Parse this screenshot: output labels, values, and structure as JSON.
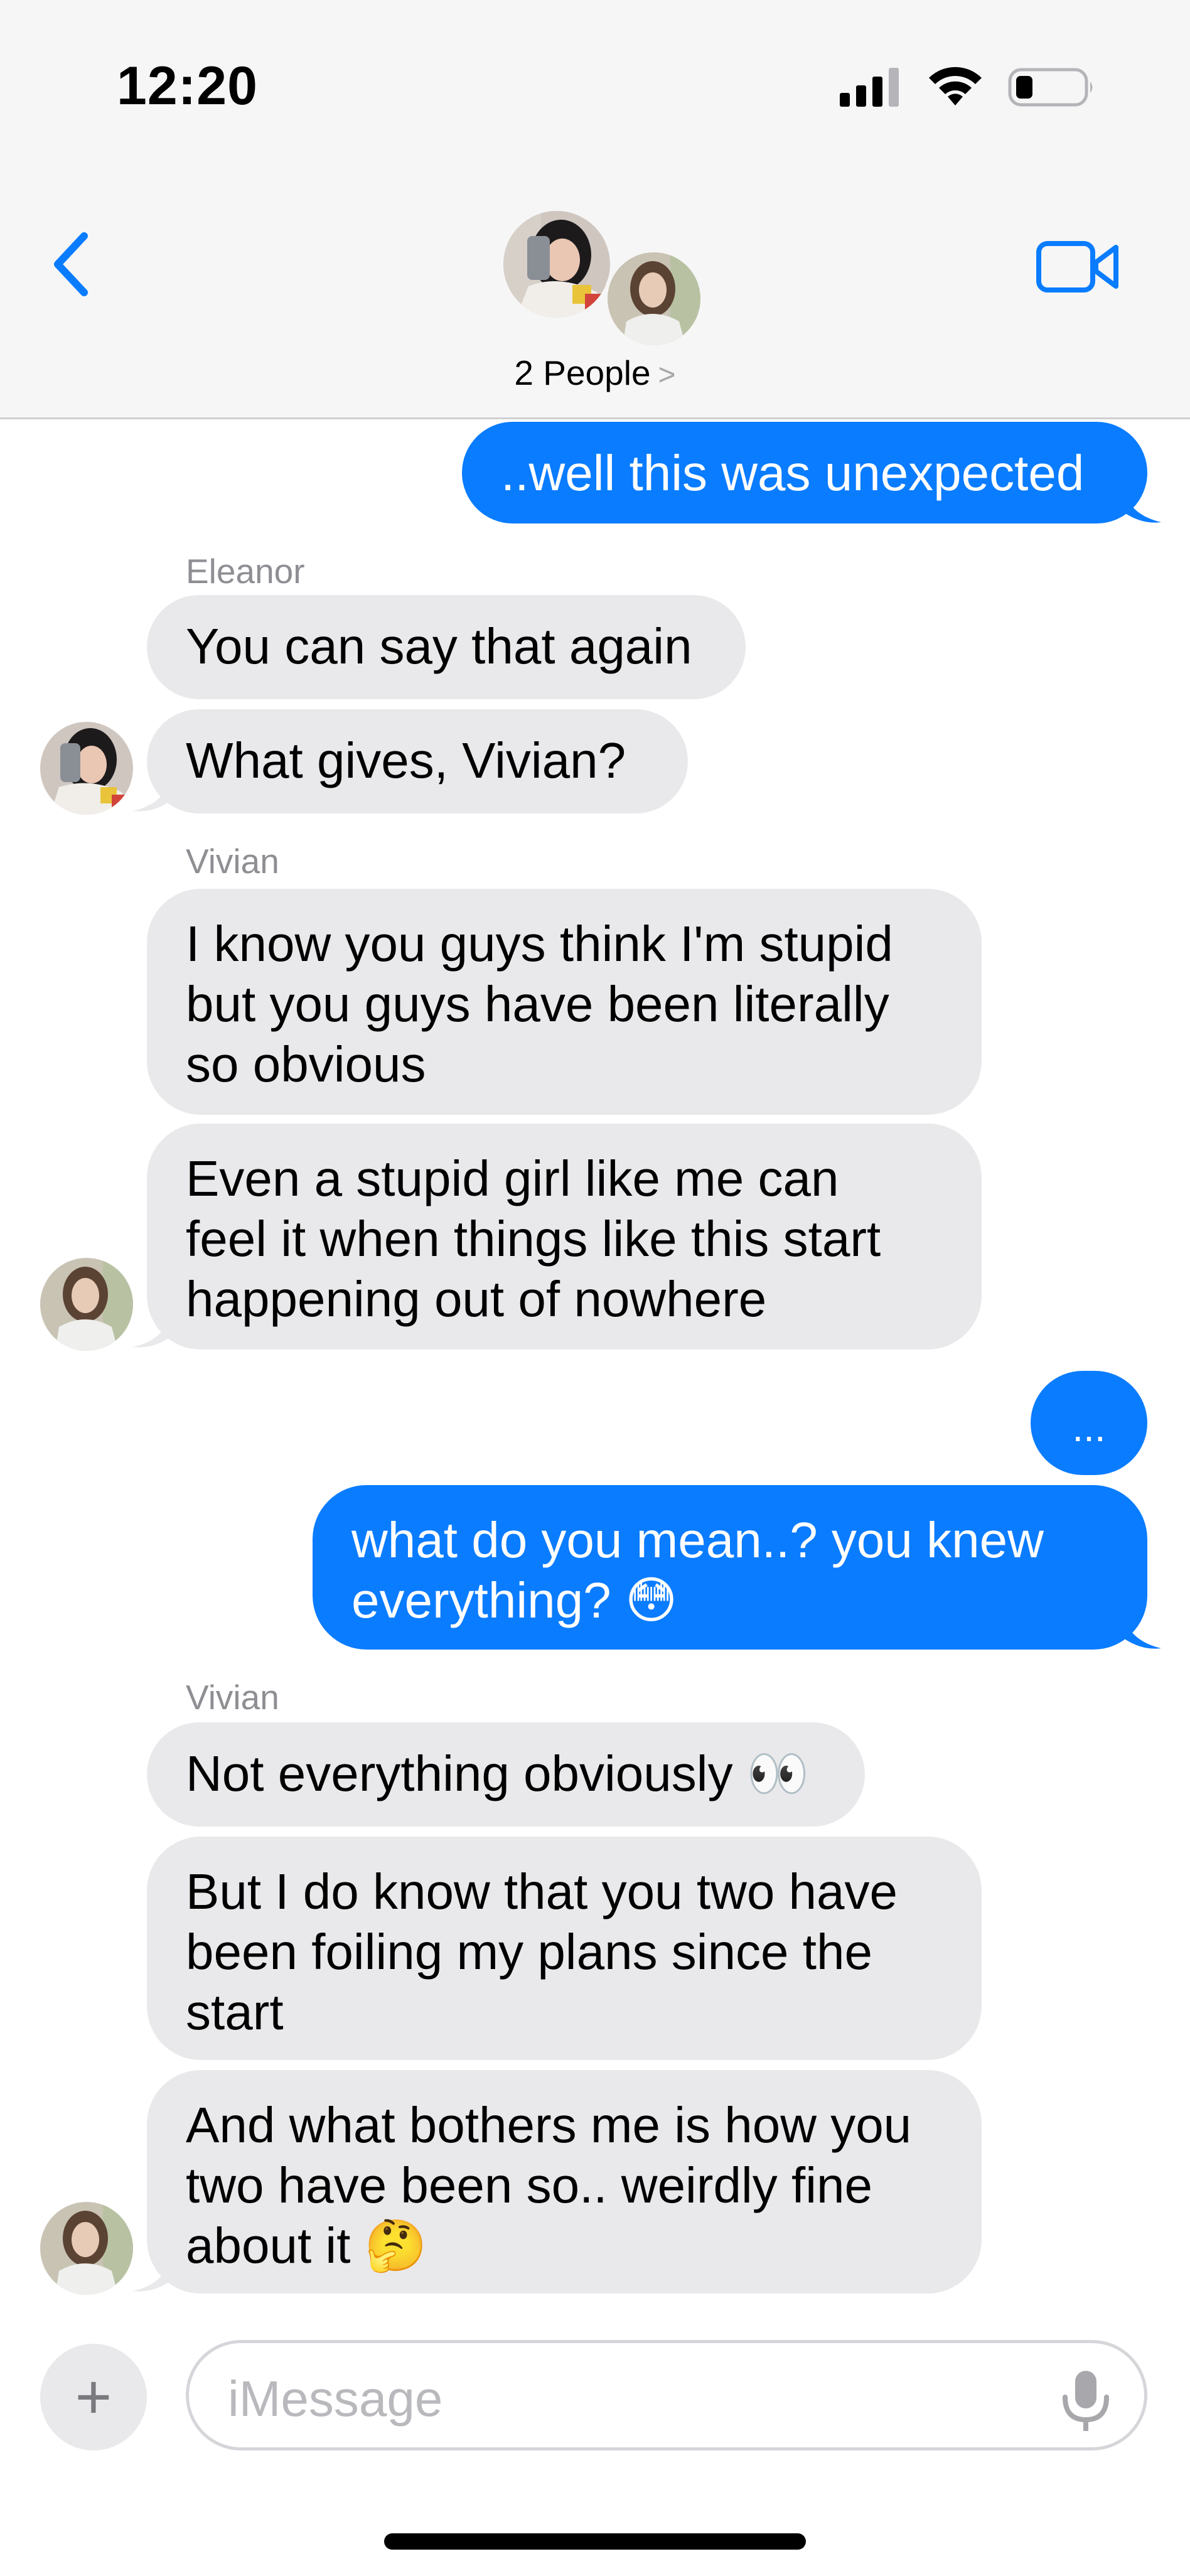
{
  "status_bar": {
    "time": "12:20"
  },
  "header": {
    "subtitle": "2 People",
    "chevron": ">"
  },
  "messages": {
    "m1": {
      "text": "..well this was unexpected"
    },
    "sender1": "Eleanor",
    "m2": {
      "text": "You can say that again"
    },
    "m3": {
      "text": "What gives, Vivian?"
    },
    "sender2": "Vivian",
    "m4": {
      "lines": [
        "I know you guys think I'm stupid",
        "but you guys have been literally",
        "so obvious"
      ]
    },
    "m5": {
      "lines": [
        "Even a stupid girl like me can",
        "feel it when things like this start",
        "happening out of nowhere"
      ]
    },
    "m6": {
      "text": "..."
    },
    "m7": {
      "lines": [
        "what do you mean..? you knew",
        "everything? 😳"
      ]
    },
    "sender3": "Vivian",
    "m8": {
      "text": "Not everything obviously 👀"
    },
    "m9": {
      "lines": [
        "But I do know that you two have",
        "been foiling my plans since the",
        "start"
      ]
    },
    "m10": {
      "lines": [
        "And what bothers me is how you",
        "two have been so.. weirdly fine",
        "about it 🤔"
      ]
    }
  },
  "composer": {
    "plus": "+",
    "placeholder": "iMessage"
  },
  "colors": {
    "outgoing": "#0a7cff",
    "incoming": "#e9e9eb",
    "accent": "#0a7cff"
  },
  "icons": [
    "back-chevron-icon",
    "video-camera-icon",
    "signal-icon",
    "wifi-icon",
    "battery-icon",
    "plus-icon",
    "microphone-icon"
  ]
}
